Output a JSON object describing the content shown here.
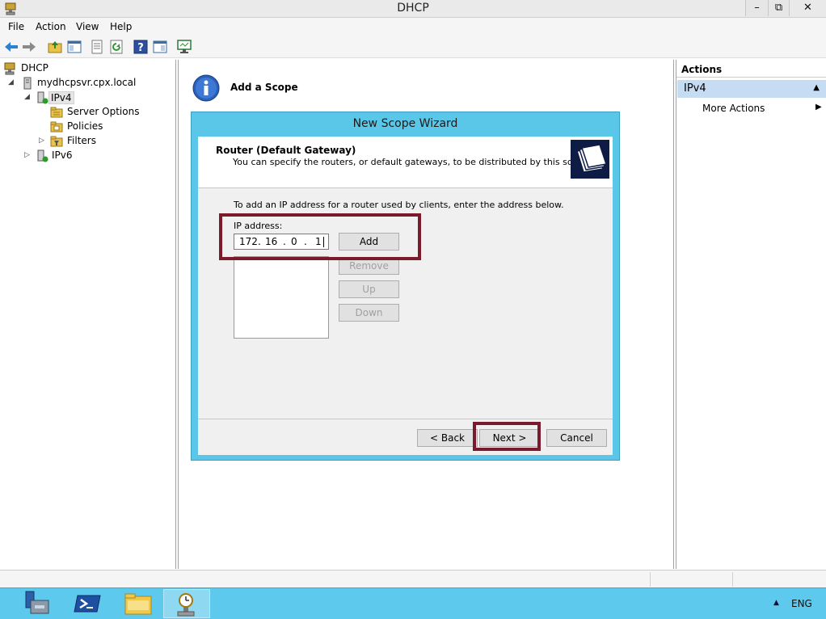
{
  "window": {
    "title": "DHCP",
    "minimize": "–",
    "maximize": "⧉",
    "close": "✕"
  },
  "menu": [
    "File",
    "Action",
    "View",
    "Help"
  ],
  "tree": {
    "root": "DHCP",
    "server": "mydhcpsvr.cpx.local",
    "ipv4": "IPv4",
    "server_options": "Server Options",
    "policies": "Policies",
    "filters": "Filters",
    "ipv6": "IPv6"
  },
  "center": {
    "heading": "Add a Scope"
  },
  "wizard": {
    "title": "New Scope Wizard",
    "header_title": "Router (Default Gateway)",
    "header_desc": "You can specify the routers, or default gateways, to be distributed by this scope.",
    "instruction": "To add an IP address for a router used by clients, enter the address below.",
    "ip_label": "IP address:",
    "ip_octets": [
      "172",
      "16",
      "0",
      "1"
    ],
    "add": "Add",
    "remove": "Remove",
    "up": "Up",
    "down": "Down",
    "back": "< Back",
    "next": "Next >",
    "cancel": "Cancel"
  },
  "actions": {
    "header": "Actions",
    "section": "IPv4",
    "more": "More Actions"
  },
  "taskbar": {
    "language": "ENG"
  },
  "colors": {
    "taskbar": "#5dc9ec",
    "wizard_frame": "#5bc7e8",
    "highlight": "#7b1a2b",
    "actions_section": "#c6dcf2"
  }
}
